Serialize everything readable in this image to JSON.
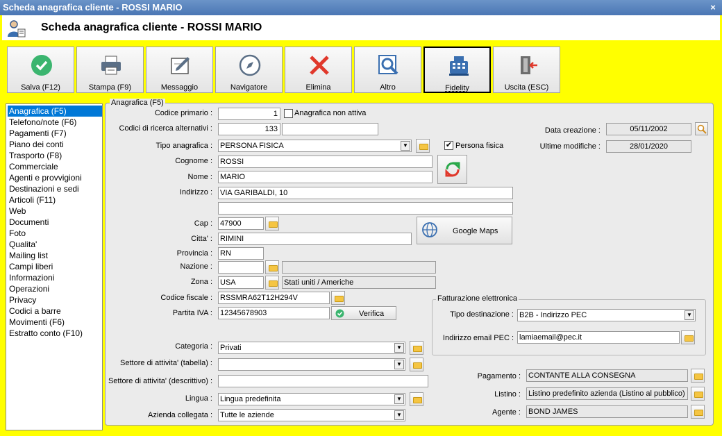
{
  "window": {
    "title": "Scheda anagrafica cliente - ROSSI MARIO",
    "close_glyph": "×"
  },
  "header": {
    "title": "Scheda anagrafica cliente - ROSSI MARIO"
  },
  "toolbar": {
    "salva": "Salva (F12)",
    "stampa": "Stampa (F9)",
    "messaggio": "Messaggio",
    "navigatore": "Navigatore",
    "elimina": "Elimina",
    "altro": "Altro",
    "fidelity": "Fidelity",
    "uscita": "Uscita (ESC)"
  },
  "nav": {
    "items": [
      "Anagrafica (F5)",
      "Telefono/note (F6)",
      "Pagamenti (F7)",
      "Piano dei conti",
      "Trasporto (F8)",
      "Commerciale",
      "Agenti e provvigioni",
      "Destinazioni e sedi",
      "Articoli (F11)",
      "Web",
      "Documenti",
      "Foto",
      "Qualita'",
      "Mailing list",
      "Campi liberi",
      "Informazioni",
      "Operazioni",
      "Privacy",
      "Codici a barre",
      "Movimenti (F6)",
      "Estratto conto (F10)"
    ],
    "selected_index": 0
  },
  "form": {
    "group_title": "Anagrafica (F5)",
    "codice_primario": {
      "label": "Codice primario :",
      "value": "1"
    },
    "anagrafica_non_attiva": {
      "label": "Anagrafica non attiva",
      "checked": false
    },
    "codici_alt": {
      "label": "Codici di ricerca alternativi :",
      "value": "133",
      "value2": ""
    },
    "tipo_anagrafica": {
      "label": "Tipo anagrafica :",
      "value": "PERSONA FISICA"
    },
    "persona_fisica": {
      "label": "Persona fisica",
      "checked": true,
      "mark": "✔"
    },
    "cognome": {
      "label": "Cognome :",
      "value": "ROSSI"
    },
    "nome": {
      "label": "Nome :",
      "value": "MARIO"
    },
    "indirizzo": {
      "label": "Indirizzo :",
      "value": "VIA GARIBALDI, 10",
      "value2": ""
    },
    "cap": {
      "label": "Cap :",
      "value": "47900"
    },
    "citta": {
      "label": "Citta' :",
      "value": "RIMINI"
    },
    "provincia": {
      "label": "Provincia :",
      "value": "RN"
    },
    "nazione": {
      "label": "Nazione :",
      "value": "",
      "desc": ""
    },
    "zona": {
      "label": "Zona :",
      "value": "USA",
      "desc": "Stati uniti / Americhe"
    },
    "codice_fiscale": {
      "label": "Codice fiscale :",
      "value": "RSSMRA62T12H294V"
    },
    "partita_iva": {
      "label": "Partita IVA :",
      "value": "12345678903"
    },
    "verifica_button": "Verifica",
    "google_maps_button": "Google Maps",
    "data_creazione": {
      "label": "Data creazione :",
      "value": "05/11/2002"
    },
    "ultime_modifiche": {
      "label": "Ultime modifiche :",
      "value": "28/01/2020"
    },
    "fatturazione": {
      "title": "Fatturazione elettronica",
      "tipo_destinazione": {
        "label": "Tipo destinazione :",
        "value": "B2B - Indirizzo PEC"
      },
      "email_pec": {
        "label": "Indirizzo email PEC :",
        "value": "lamiaemail@pec.it"
      }
    },
    "categoria": {
      "label": "Categoria :",
      "value": "Privati"
    },
    "settore_tabella": {
      "label": "Settore di attivita' (tabella) :",
      "value": ""
    },
    "settore_descrittivo": {
      "label": "Settore di attivita' (descrittivo) :",
      "value": ""
    },
    "lingua": {
      "label": "Lingua :",
      "value": "Lingua predefinita"
    },
    "azienda_collegata": {
      "label": "Azienda collegata :",
      "value": "Tutte le aziende"
    },
    "pagamento": {
      "label": "Pagamento :",
      "value": "CONTANTE ALLA CONSEGNA"
    },
    "listino": {
      "label": "Listino :",
      "value": "Listino predefinito azienda (Listino al pubblico)"
    },
    "agente": {
      "label": "Agente :",
      "value": "BOND JAMES"
    }
  },
  "colors": {
    "frame": "#ffff00",
    "titlebar": "#4a76b4",
    "selection": "#0078d7"
  }
}
